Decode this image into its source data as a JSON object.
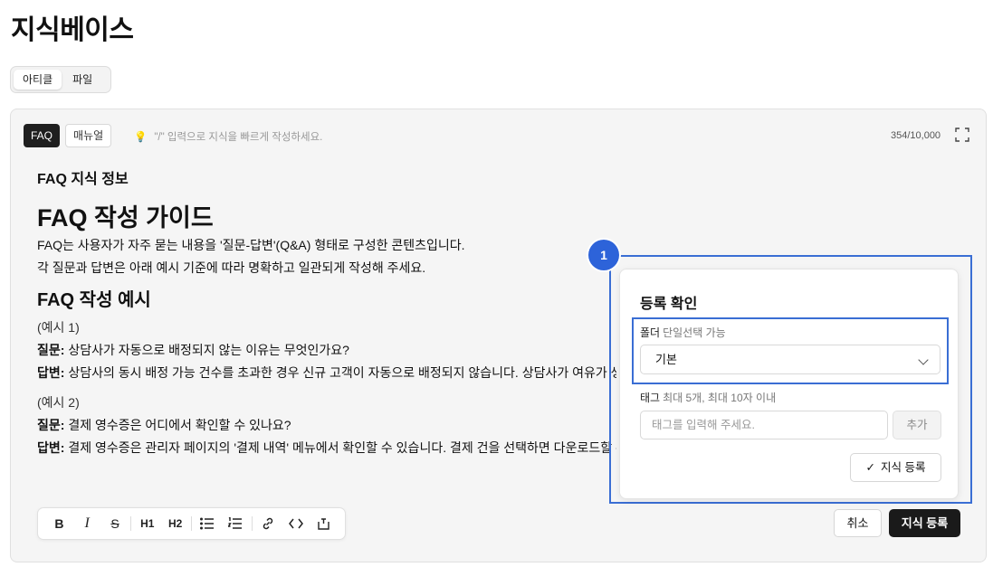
{
  "page": {
    "title": "지식베이스"
  },
  "tabs": [
    "아티클",
    "파일"
  ],
  "editor": {
    "type_chips": [
      "FAQ",
      "매뉴얼"
    ],
    "hint": "\"/\" 입력으로 지식을 빠르게 작성하세요.",
    "char_count": "354/10,000"
  },
  "document": {
    "meta_title": "FAQ 지식 정보",
    "h1": "FAQ 작성 가이드",
    "intro": [
      "FAQ는 사용자가 자주 묻는 내용을 '질문-답변'(Q&A) 형태로 구성한 콘텐츠입니다.",
      "각 질문과 답변은 아래 예시 기준에 따라 명확하고 일관되게 작성해 주세요."
    ],
    "h2": "FAQ 작성 예시",
    "examples": [
      {
        "label": "(예시 1)",
        "q_label": "질문:",
        "q_text": " 상담사가 자동으로 배정되지 않는 이유는 무엇인가요?",
        "a_label": "답변:",
        "a_text": " 상담사의 동시 배정 가능 건수를 초과한 경우 신규 고객이 자동으로 배정되지 않습니다. 상담사가 여유가 생기면 자동으로 배정됩니다."
      },
      {
        "label": "(예시 2)",
        "q_label": "질문:",
        "q_text": " 결제 영수증은 어디에서 확인할 수 있나요?",
        "a_label": "답변:",
        "a_text": " 결제 영수증은 관리자 페이지의 '결제 내역' 메뉴에서 확인할 수 있습니다. 결제 건을 선택하면 다운로드할 수 있습니다."
      }
    ]
  },
  "toolbar": {
    "icons": [
      "bold-icon",
      "italic-icon",
      "strikethrough-icon",
      "heading1-icon",
      "heading2-icon",
      "bullet-list-icon",
      "ordered-list-icon",
      "link-icon",
      "code-icon",
      "insert-block-icon"
    ],
    "glyphs": [
      "B",
      "I",
      "S",
      "H1",
      "H2",
      "☰",
      "≡",
      "🔗",
      "<>",
      "⌗"
    ]
  },
  "actions": {
    "cancel": "취소",
    "register": "지식 등록"
  },
  "annotation": {
    "badge": "1"
  },
  "dialog": {
    "title": "등록 확인",
    "folder_label": "폴더",
    "folder_sub": "단일선택 가능",
    "folder_value": "기본",
    "tag_label": "태그",
    "tag_sub": "최대 5개, 최대 10자 이내",
    "tag_placeholder": "태그를 입력해 주세요.",
    "tag_add": "추가",
    "submit": "지식 등록",
    "submit_icon": "✓"
  }
}
